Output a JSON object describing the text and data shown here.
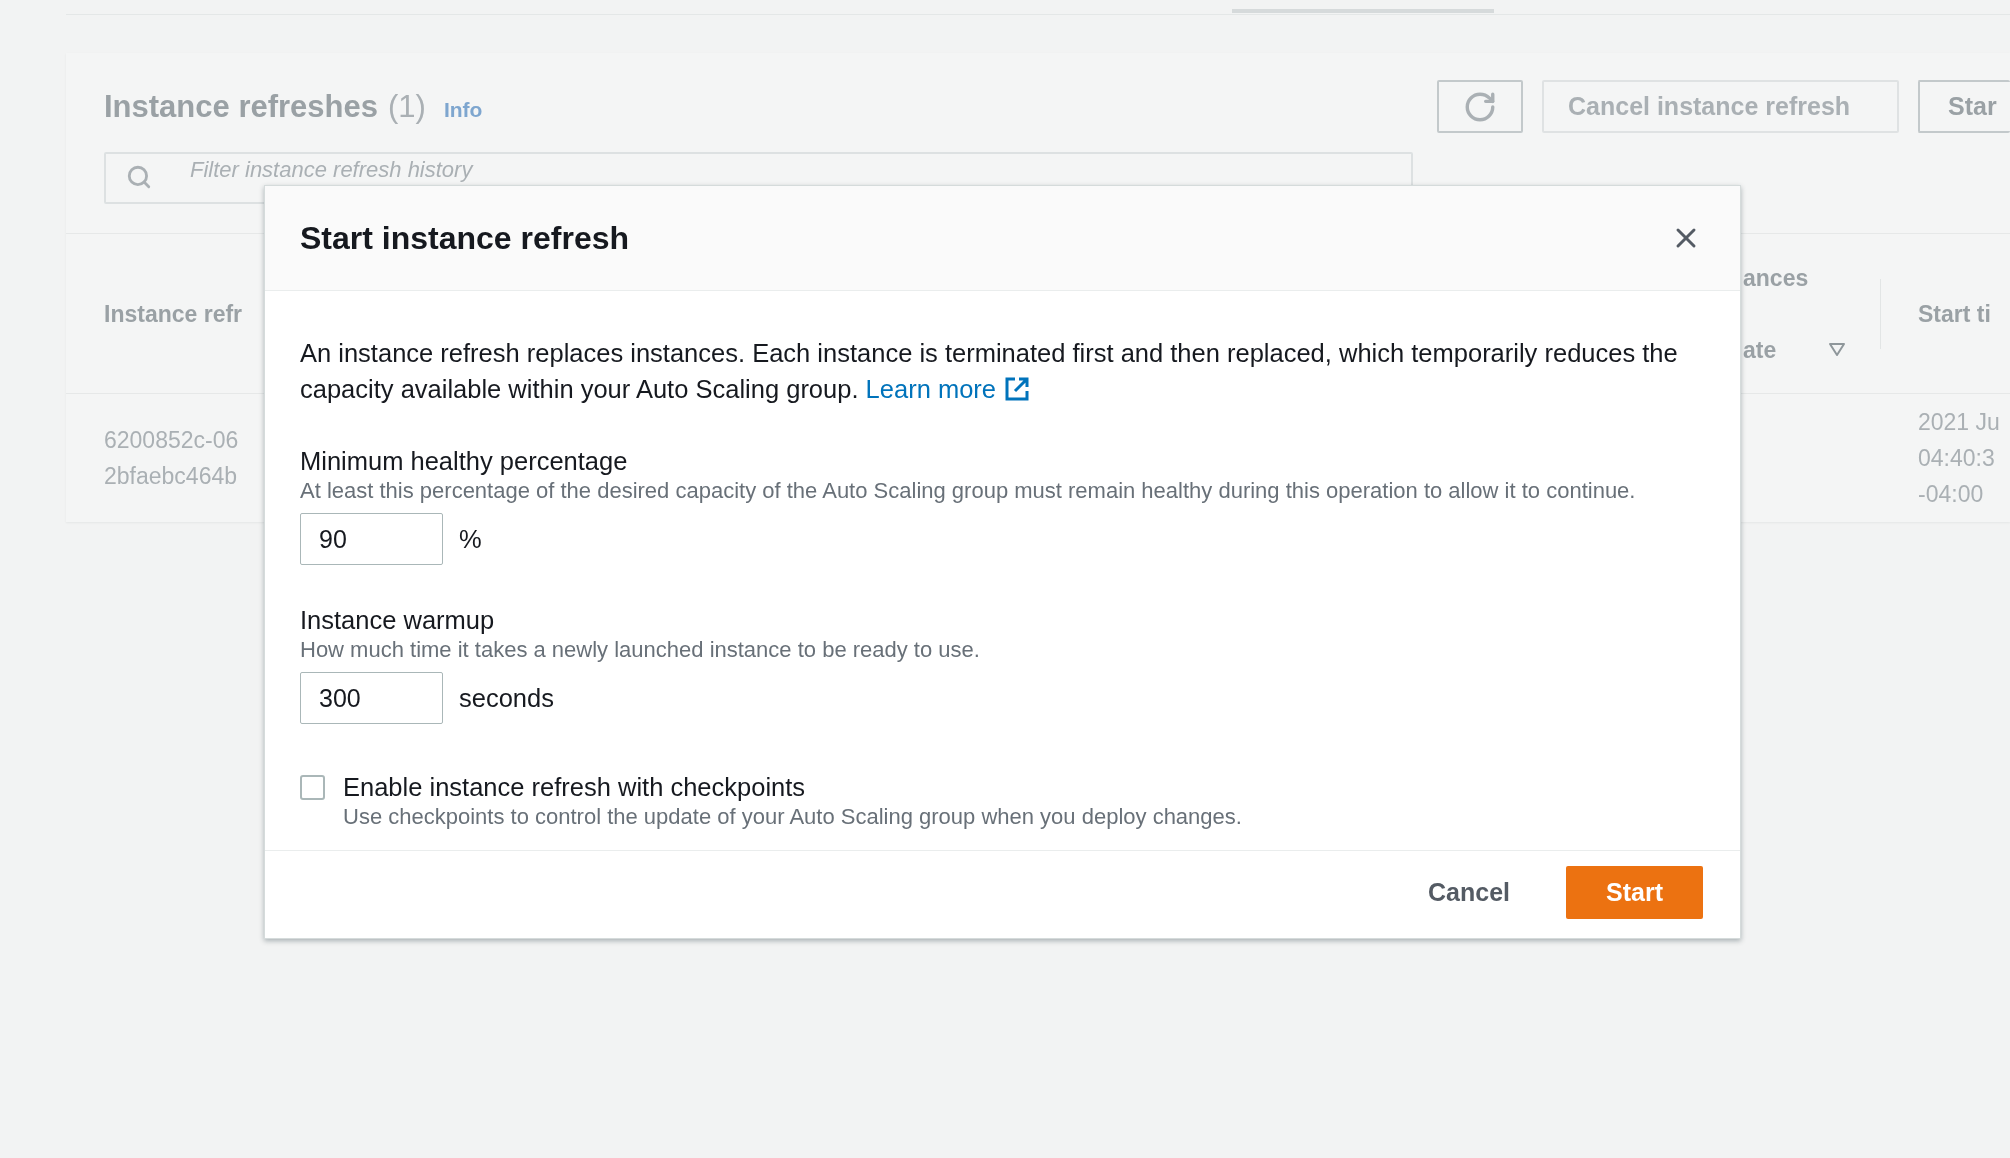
{
  "background_page": {
    "panel": {
      "title": "Instance refreshes",
      "count": "(1)",
      "info_link": "Info",
      "actions": [
        {
          "kind": "refresh",
          "disabled": false
        },
        {
          "kind": "text",
          "label": "Cancel instance refresh",
          "disabled": true
        },
        {
          "kind": "text",
          "label": "Star",
          "disabled": false
        }
      ],
      "search": {
        "placeholder": "Filter instance refresh history"
      },
      "table": {
        "columns": [
          {
            "lines": [
              "Instance refr"
            ],
            "sortable": false
          },
          {
            "lines": [
              "ances",
              "ate"
            ],
            "sortable": true
          },
          {
            "lines": [
              "Start ti"
            ],
            "sortable": false
          }
        ],
        "rows": [
          {
            "column_1": [
              "6200852c-06",
              "2bfaebc464b"
            ],
            "column_3": [
              "2021 Ju",
              "04:40:3",
              "-04:00"
            ]
          }
        ]
      }
    }
  },
  "modal": {
    "title": "Start instance refresh",
    "intro": "An instance refresh replaces instances. Each instance is terminated first and then replaced, which temporarily reduces the capacity available within your Auto Scaling group.",
    "learn_more": "Learn more",
    "fields": [
      {
        "label": "Minimum healthy percentage",
        "description": "At least this percentage of the desired capacity of the Auto Scaling group must remain healthy during this operation to allow it to continue.",
        "value": "90",
        "unit": "%"
      },
      {
        "label": "Instance warmup",
        "description": "How much time it takes a newly launched instance to be ready to use.",
        "value": "300",
        "unit": "seconds"
      }
    ],
    "checkpoints": {
      "label": "Enable instance refresh with checkpoints",
      "description": "Use checkpoints to control the update of your Auto Scaling group when you deploy changes.",
      "checked": false
    },
    "buttons": [
      {
        "kind": "link",
        "label": "Cancel"
      },
      {
        "kind": "primary",
        "label": "Start"
      }
    ]
  }
}
